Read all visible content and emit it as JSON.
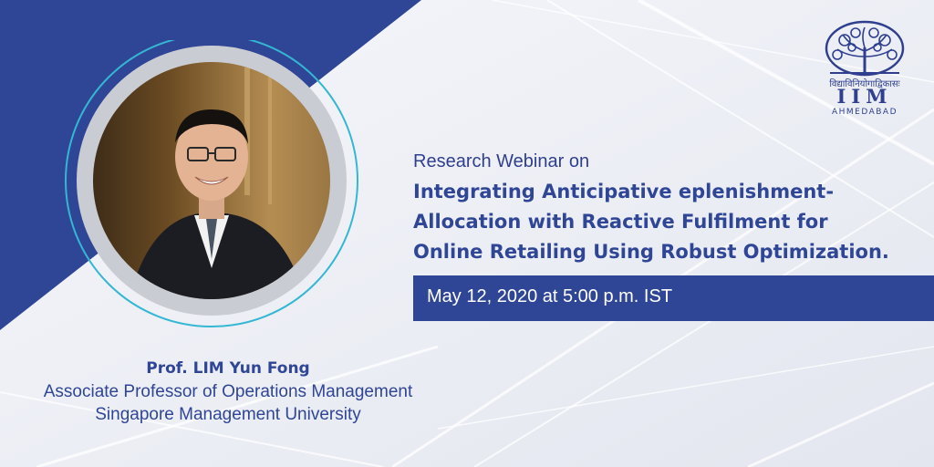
{
  "colors": {
    "brand_blue": "#2f4596",
    "accent_cyan": "#34b7d3",
    "background": "#eef0f6",
    "ring_grey": "#c9ccd3"
  },
  "logo": {
    "icon": "iim-tree-emblem-icon",
    "script_text": "विद्याविनियोगाद्विकासः",
    "letters": "IIM",
    "city": "AHMEDABAD"
  },
  "event": {
    "subtitle": "Research Webinar on",
    "title_lines": [
      "Integrating Anticipative eplenishment-",
      "Allocation with Reactive Fulfilment for",
      "Online Retailing Using Robust Optimization."
    ],
    "date": "May 12, 2020 at 5:00 p.m. IST"
  },
  "speaker": {
    "photo_icon": "speaker-portrait",
    "name": "Prof. LIM Yun Fong",
    "role": "Associate Professor of Operations Management",
    "organization": "Singapore Management University"
  }
}
